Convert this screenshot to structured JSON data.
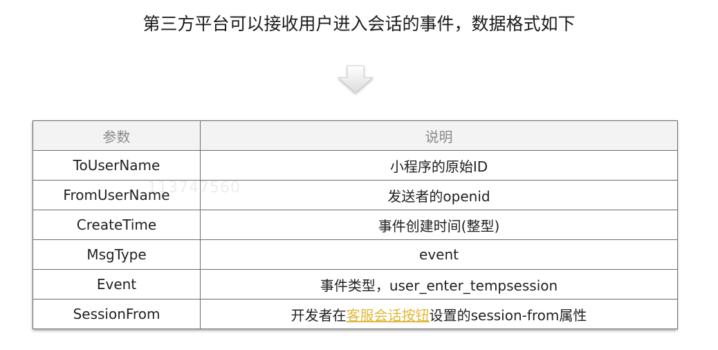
{
  "heading": "第三方平台可以接收用户进入会话的事件，数据格式如下",
  "watermark": "113747560",
  "table": {
    "headers": [
      "参数",
      "说明"
    ],
    "rows": [
      {
        "param": "ToUserName",
        "desc": "小程序的原始ID"
      },
      {
        "param": "FromUserName",
        "desc": "发送者的openid"
      },
      {
        "param": "CreateTime",
        "desc": "事件创建时间(整型)"
      },
      {
        "param": "MsgType",
        "desc": "event"
      },
      {
        "param": "Event",
        "desc": "事件类型，user_enter_tempsession"
      },
      {
        "param": "SessionFrom",
        "desc_prefix": "开发者在",
        "desc_link": "客服会话按钮",
        "desc_suffix": "设置的session-from属性"
      }
    ]
  },
  "colors": {
    "link": "#e0b83a",
    "header_bg": "#f3f3f3",
    "border": "#6b6b6b"
  },
  "icons": {
    "down_arrow": "down-arrow-icon"
  }
}
